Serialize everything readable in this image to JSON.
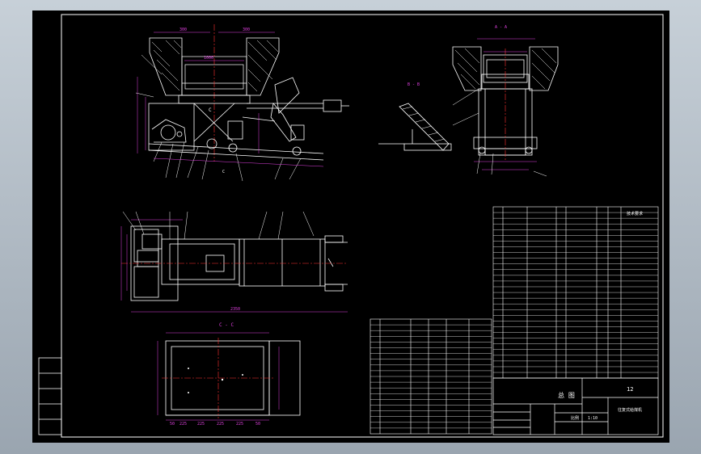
{
  "drawing": {
    "section_c": "C - C",
    "section_b": "B - B",
    "section_a": "A - A",
    "title_center": "总  图",
    "sheet_no": "12",
    "drawing_name": "往复式给煤机",
    "scale_label": "比例",
    "scale_value": "1:10",
    "parts_header": "技术要求"
  },
  "colors": {
    "background": "#000000",
    "lines": "#ffffff",
    "dimensions": "#e040e0",
    "hatching": "#ffffff",
    "centerline": "#ff3030"
  }
}
